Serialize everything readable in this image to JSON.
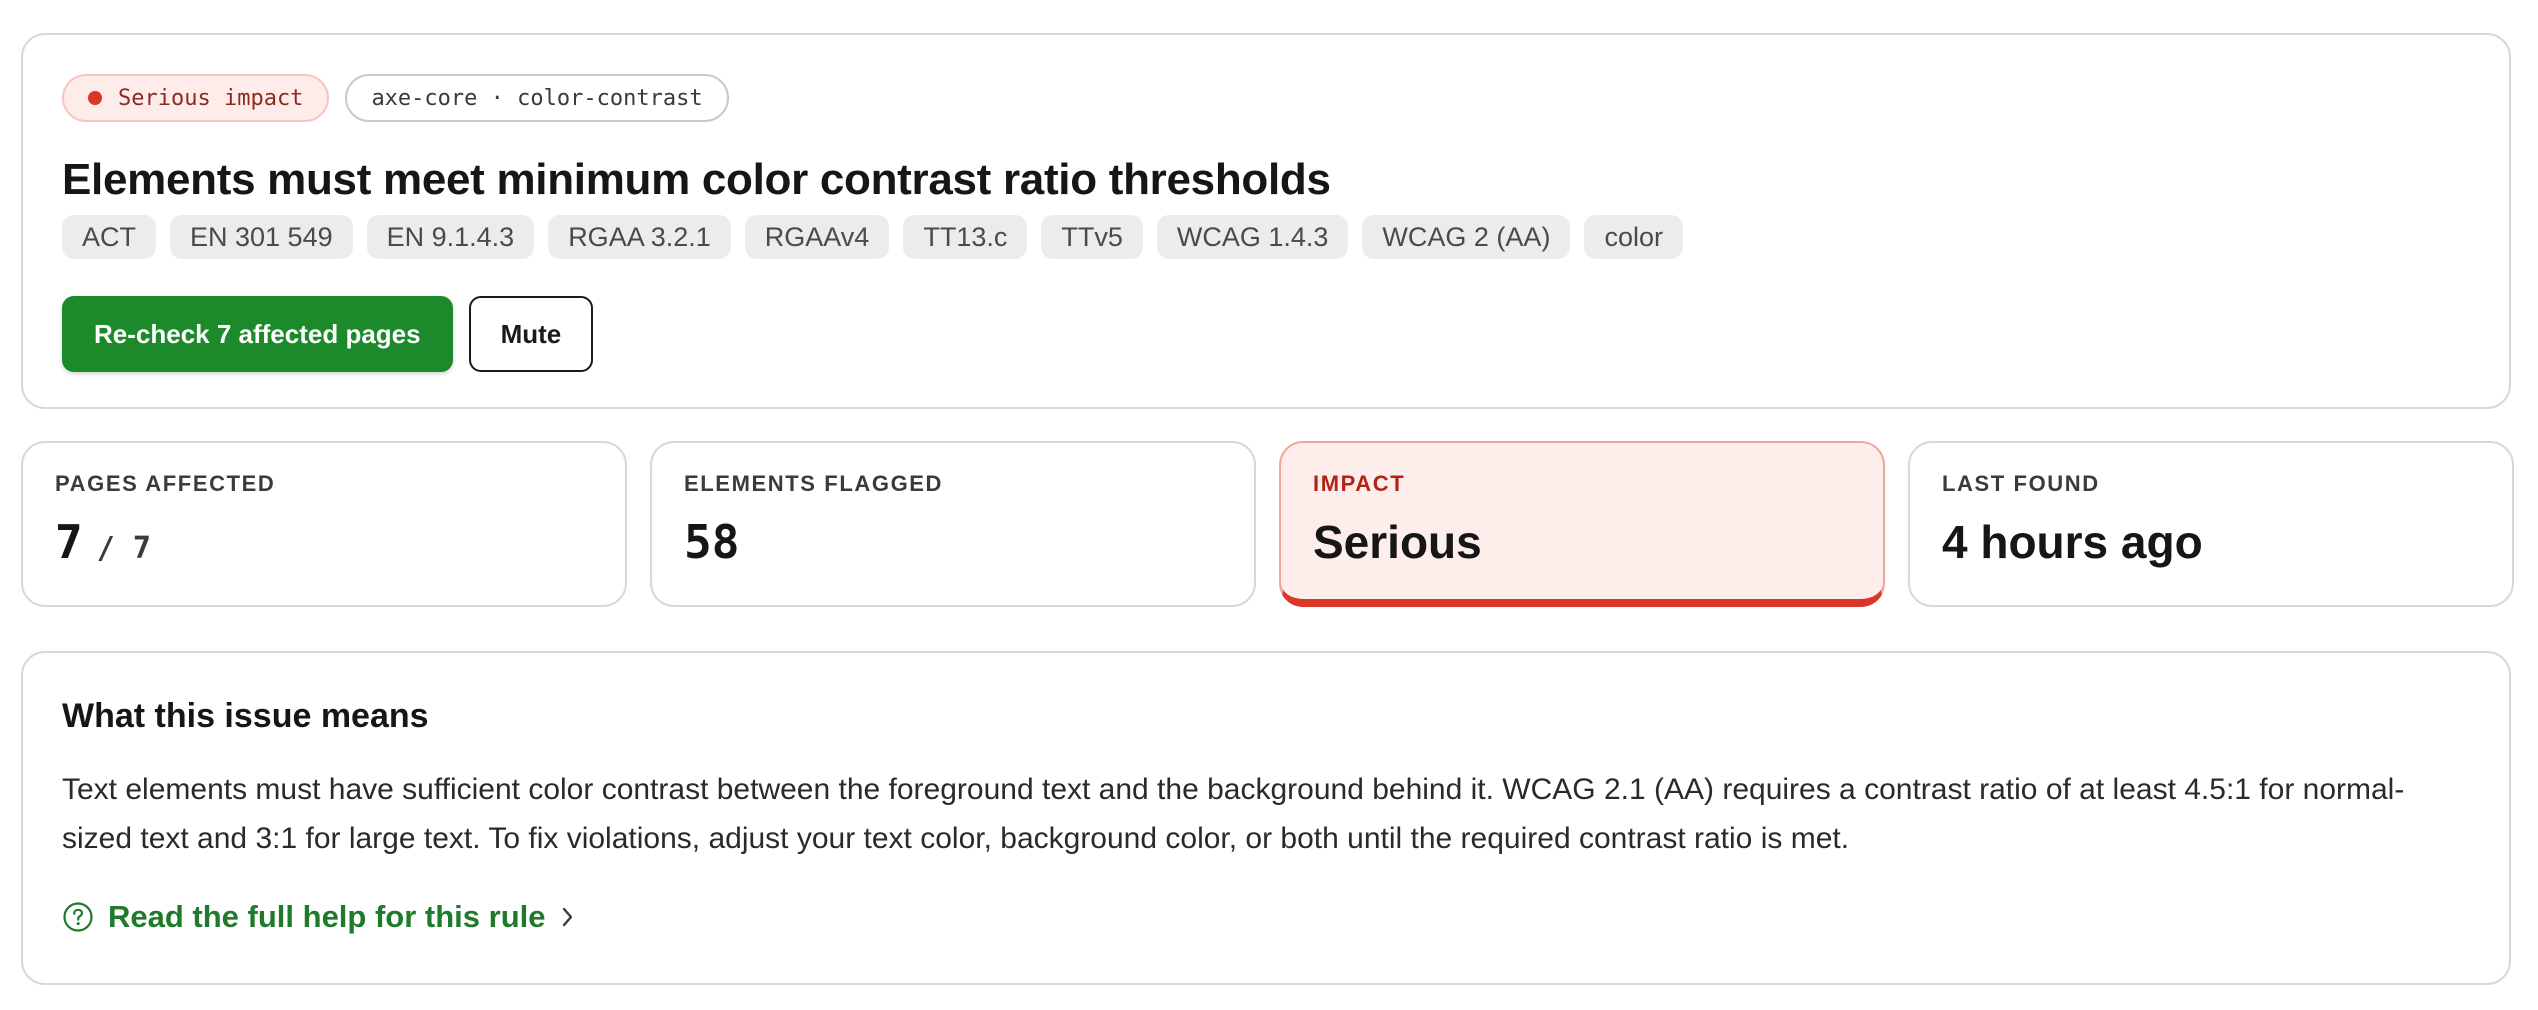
{
  "header": {
    "impact_pill": "Serious impact",
    "rule_pill": "axe-core · color-contrast",
    "title": "Elements must meet minimum color contrast ratio thresholds",
    "tags": [
      "ACT",
      "EN 301 549",
      "EN 9.1.4.3",
      "RGAA 3.2.1",
      "RGAAv4",
      "TT13.c",
      "TTv5",
      "WCAG 1.4.3",
      "WCAG 2 (AA)",
      "color"
    ],
    "primary_button": "Re-check 7 affected pages",
    "secondary_button": "Mute"
  },
  "stats": {
    "pages": {
      "label": "PAGES AFFECTED",
      "value": "7",
      "total": "/ 7"
    },
    "elements": {
      "label": "ELEMENTS FLAGGED",
      "value": "58"
    },
    "impact": {
      "label": "IMPACT",
      "value": "Serious"
    },
    "last_found": {
      "label": "LAST FOUND",
      "value": "4 hours ago"
    }
  },
  "explanation": {
    "heading": "What this issue means",
    "body": "Text elements must have sufficient color contrast between the foreground text and the background behind it. WCAG 2.1 (AA) requires a contrast ratio of at least 4.5:1 for normal-sized text and 3:1 for large text. To fix violations, adjust your text color, background color, or both until the required contrast ratio is met.",
    "help_link": "Read the full help for this rule",
    "help_icon": "question-circle-icon",
    "link_arrow_icon": "chevron-right-icon"
  },
  "colors": {
    "primary": "#1c8a2b",
    "link": "#1f7a2b",
    "serious": "#d9372a",
    "serious_bg": "#fdeeec"
  }
}
